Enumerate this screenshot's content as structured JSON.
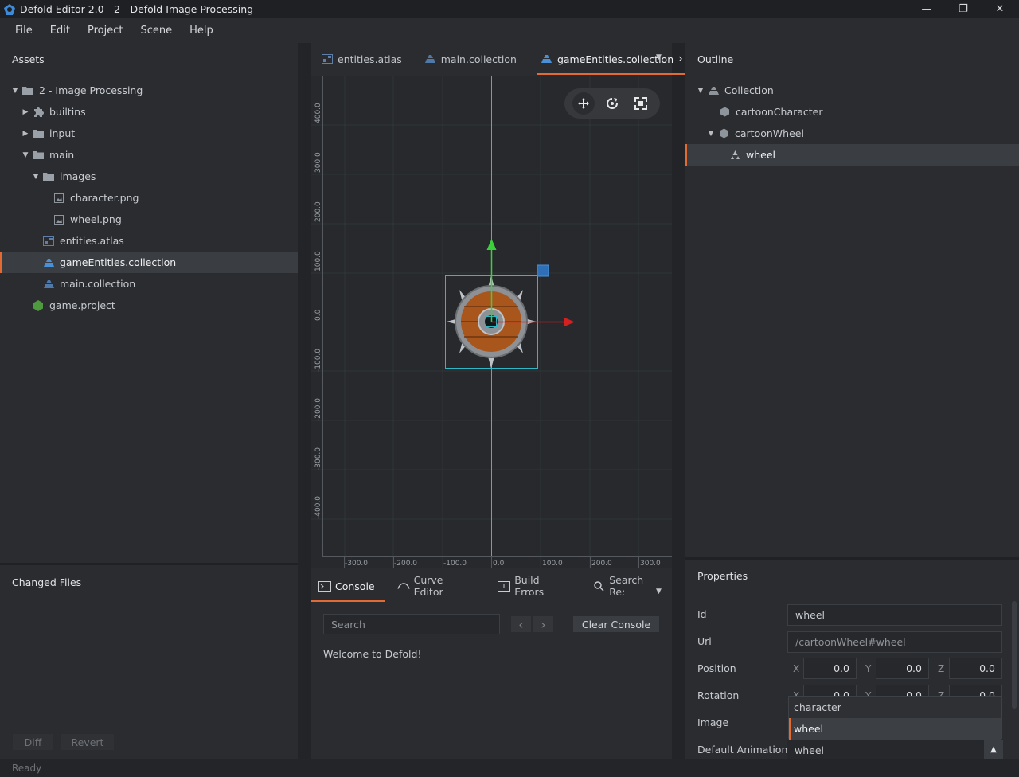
{
  "window": {
    "title": "Defold Editor 2.0 - 2 - Defold Image Processing",
    "minimize": "—",
    "restore": "❐",
    "close": "✕"
  },
  "menu": [
    "File",
    "Edit",
    "Project",
    "Scene",
    "Help"
  ],
  "assets": {
    "title": "Assets",
    "items": [
      {
        "label": "2 - Image Processing",
        "icon": "folder-icon",
        "expanded": true
      },
      {
        "label": "builtins",
        "icon": "puzzle-icon",
        "expanded": false
      },
      {
        "label": "input",
        "icon": "folder-icon",
        "expanded": false
      },
      {
        "label": "main",
        "icon": "folder-icon",
        "expanded": true
      },
      {
        "label": "images",
        "icon": "folder-icon",
        "expanded": true
      },
      {
        "label": "character.png",
        "icon": "image-icon"
      },
      {
        "label": "wheel.png",
        "icon": "image-icon"
      },
      {
        "label": "entities.atlas",
        "icon": "atlas-icon"
      },
      {
        "label": "gameEntities.collection",
        "icon": "collection-icon",
        "selected": true
      },
      {
        "label": "main.collection",
        "icon": "collection-icon"
      },
      {
        "label": "game.project",
        "icon": "project-icon"
      }
    ]
  },
  "changed_files": {
    "title": "Changed Files",
    "diff_label": "Diff",
    "revert_label": "Revert"
  },
  "editor_tabs": {
    "tabs": [
      {
        "label": "entities.atlas"
      },
      {
        "label": "main.collection"
      },
      {
        "label": "gameEntities.collection",
        "active": true
      }
    ],
    "more": "›"
  },
  "viewport": {
    "y_ticks": [
      "400.0",
      "300.0",
      "200.0",
      "100.0",
      "0.0",
      "-100.0",
      "-200.0",
      "-300.0",
      "-400.0"
    ],
    "x_ticks": [
      "-300.0",
      "-200.0",
      "-100.0",
      "0.0",
      "100.0",
      "200.0",
      "300.0"
    ],
    "tools": [
      "move-tool-icon",
      "rotate-tool-icon",
      "scale-tool-icon"
    ]
  },
  "console": {
    "tabs": [
      {
        "label": "Console",
        "active": true
      },
      {
        "label": "Curve Editor"
      },
      {
        "label": "Build Errors"
      },
      {
        "label": "Search Re:"
      }
    ],
    "search_placeholder": "Search",
    "prev": "‹",
    "next": "›",
    "clear_label": "Clear Console",
    "output": "Welcome to Defold!"
  },
  "outline": {
    "title": "Outline",
    "items": [
      {
        "label": "Collection",
        "expanded": true
      },
      {
        "label": "cartoonCharacter"
      },
      {
        "label": "cartoonWheel",
        "expanded": true
      },
      {
        "label": "wheel",
        "selected": true
      }
    ]
  },
  "properties": {
    "title": "Properties",
    "id_label": "Id",
    "id_value": "wheel",
    "url_label": "Url",
    "url_value": "/cartoonWheel#wheel",
    "position_label": "Position",
    "rotation_label": "Rotation",
    "image_label": "Image",
    "default_animation_label": "Default Animation",
    "default_animation_value": "wheel",
    "x": "X",
    "y": "Y",
    "z": "Z",
    "position": [
      "0.0",
      "0.0",
      "0.0"
    ],
    "rotation": [
      "0.0",
      "0.0",
      "0.0"
    ],
    "image_options": [
      "character",
      "wheel"
    ],
    "image_selected": "wheel"
  },
  "status": "Ready",
  "colors": {
    "accent": "#e26a35",
    "x_axis": "#d42020",
    "y_axis": "#3bd13b",
    "selection": "#2fb7c6",
    "collection_icon": "#4a90d9"
  }
}
